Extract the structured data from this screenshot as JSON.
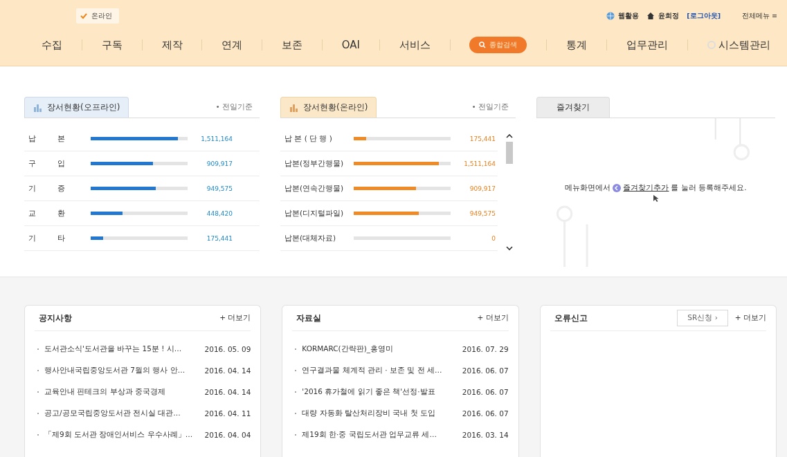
{
  "header": {
    "mode_badge": "온라인",
    "utility": [
      {
        "kind": "globe",
        "label": "웹활용"
      },
      {
        "kind": "home",
        "label": "윤희정"
      },
      {
        "kind": "logout",
        "label": "[로그아웃]"
      }
    ],
    "all_menu": "전체메뉴 ≡"
  },
  "nav": [
    {
      "kind": "link",
      "label": "수집"
    },
    {
      "kind": "link",
      "label": "구독"
    },
    {
      "kind": "link",
      "label": "제작"
    },
    {
      "kind": "link",
      "label": "연계"
    },
    {
      "kind": "link",
      "label": "보존"
    },
    {
      "kind": "link",
      "label": "OAI"
    },
    {
      "kind": "link",
      "label": "서비스"
    },
    {
      "kind": "search",
      "label": "종합검색"
    },
    {
      "kind": "link",
      "label": "통계"
    },
    {
      "kind": "link",
      "label": "업무관리"
    },
    {
      "kind": "icon-link",
      "label": "시스템관리"
    }
  ],
  "offline": {
    "title": "장서현황(오프라인)",
    "note": "• 전일기준",
    "rows": [
      {
        "label": "납 본",
        "level": 0.9,
        "value": "1,511,164"
      },
      {
        "label": "구 입",
        "level": 0.64,
        "value": "909,917"
      },
      {
        "label": "기 증",
        "level": 0.67,
        "value": "949,575"
      },
      {
        "label": "교 환",
        "level": 0.33,
        "value": "448,420"
      },
      {
        "label": "기 타",
        "level": 0.13,
        "value": "175,441"
      }
    ]
  },
  "online": {
    "title": "장서현황(온라인)",
    "note": "• 전일기준",
    "rows": [
      {
        "label": "납 본 ( 단 행 )",
        "level": 0.13,
        "value": "175,441"
      },
      {
        "label": "납본(정부간행물)",
        "level": 0.88,
        "value": "1,511,164"
      },
      {
        "label": "납본(연속간행물)",
        "level": 0.64,
        "value": "909,917"
      },
      {
        "label": "납본(디지털파일)",
        "level": 0.67,
        "value": "949,575"
      },
      {
        "label": "납본(대체자료)",
        "value": "0"
      }
    ]
  },
  "favorites": {
    "tab": "즐겨찾기",
    "message_before": "메뉴화면에서",
    "link": "즐겨찾기추가",
    "message_after": "를 눌러 등록해주세요."
  },
  "boards": [
    {
      "kind": "list",
      "title": "공지사항",
      "more": "+ 더보기",
      "items": [
        {
          "title": "도서관소식'도서관을 바꾸는 15분 ! 시…",
          "date": "2016. 05. 09"
        },
        {
          "title": "행사안내국립중앙도서관 7월의 행사 안…",
          "date": "2016. 04. 14"
        },
        {
          "title": "교육안내 핀테크의 부상과 중국경제",
          "date": "2016. 04. 14"
        },
        {
          "title": "공고/공모국립중앙도서관 전시실 대관…",
          "date": "2016. 04. 11"
        },
        {
          "title": "「제9회 도서관 장애인서비스 우수사례」…",
          "date": "2016. 04. 04"
        }
      ]
    },
    {
      "kind": "list",
      "title": "자료실",
      "more": "+ 더보기",
      "items": [
        {
          "title": "KORMARC(간략판)_홍영미",
          "date": "2016. 07. 29"
        },
        {
          "title": "연구결과물 체계적 관리 · 보존 및 전 세…",
          "date": "2016. 06. 07"
        },
        {
          "title": "'2016 휴가철에 읽기 좋은 책'선정·발표",
          "date": "2016. 06. 07"
        },
        {
          "title": "대량 자동화 탈산처리장비 국내 첫 도입",
          "date": "2016. 06. 07"
        },
        {
          "title": "제19회 한·중 국립도서관 업무교류 세…",
          "date": "2016. 03. 14"
        }
      ]
    },
    {
      "kind": "report",
      "title": "오류신고",
      "action": "SR신청 ›",
      "more": "+ 더보기"
    }
  ]
}
